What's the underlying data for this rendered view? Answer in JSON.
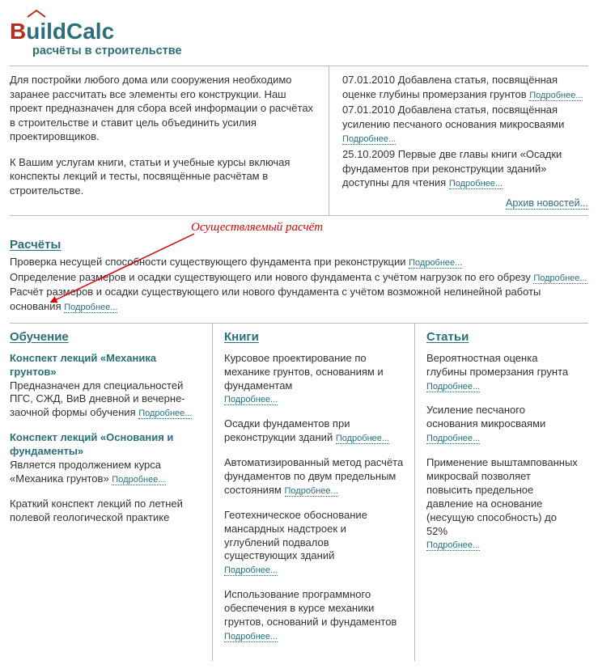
{
  "logo": {
    "b": "B",
    "rest": "uildCalc",
    "sub": "расчёты в строительстве"
  },
  "intro": {
    "p1": "Для постройки любого дома или сооружения необходимо заранее рассчитать все элементы его конструкции. Наш проект предназначен для сбора всей информации о расчётах в строительстве и ставит цель объединить усилия проектировщиков.",
    "p2": "К Вашим услугам книги, статьи и учебные курсы включая конспекты лекций и тесты, посвящённые расчётам в строительстве."
  },
  "news": {
    "items": [
      {
        "date": "07.01.2010",
        "text": "Добавлена статья, посвящённая оценке глубины промерзания грунтов"
      },
      {
        "date": "07.01.2010",
        "text": "Добавлена статья, посвящённая усилению песчаного основания микросваями"
      },
      {
        "date": "25.10.2009",
        "text": "Первые две главы книги «Осадки фундаментов при реконструкции зданий» доступны для чтения"
      }
    ],
    "archive": "Архив новостей..."
  },
  "more_label": "Подробнее...",
  "annotation": "Осуществляемый расчёт",
  "calc": {
    "heading": "Расчёты",
    "lines": [
      "Проверка несущей способности существующего фундамента при реконструкции",
      "Определение размеров и осадки существующего или нового фундамента с учётом нагрузок по его обрезу",
      "Расчёт размеров и осадки существующего или нового фундамента с учётом возможной нелинейной работы основания"
    ]
  },
  "education": {
    "heading": "Обучение",
    "items": [
      {
        "title": "Конспект лекций «Механика грунтов»",
        "body": "Предназначен для специальностей ПГС, СЖД, ВиВ дневной и вечерне-заочной формы обучения",
        "more": true
      },
      {
        "title": "Конспект лекций «Основания и фундаменты»",
        "body": "Является продолжением курса «Механика грунтов»",
        "more": true
      },
      {
        "title": "",
        "body": "Краткий конспект лекций по летней полевой геологической практике",
        "more": false
      }
    ]
  },
  "books": {
    "heading": "Книги",
    "items": [
      "Курсовое проектирование по механике грунтов, основаниям и фундаментам",
      "Осадки фундаментов при реконструкции зданий",
      "Автоматизированный метод расчёта фундаментов по двум предельным состояниям",
      "Геотехническое обоснование мансардных надстроек и углублений подвалов существующих зданий",
      "Использование программного обеспечения в курсе механики грунтов, оснований и фундаментов"
    ]
  },
  "articles": {
    "heading": "Статьи",
    "items": [
      "Вероятностная оценка глубины промерзания грунта",
      "Усиление песчаного основания микросваями",
      "Применение выштампованных микросвай позволяет повысить предельное давление на основание (несущую способность) до 52%"
    ]
  }
}
